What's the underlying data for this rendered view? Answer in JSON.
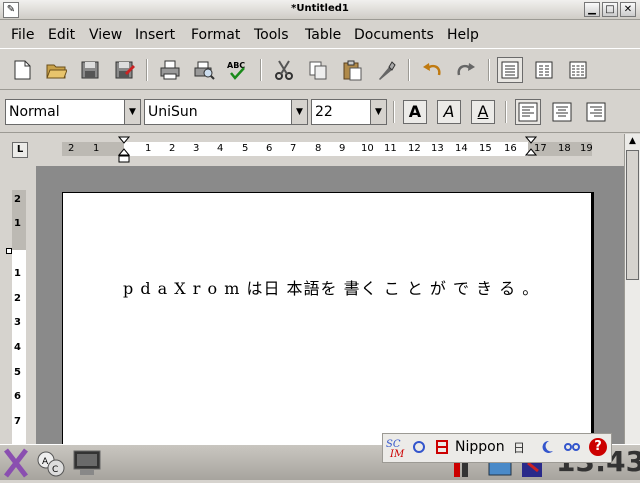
{
  "window": {
    "title": "*Untitled1",
    "min": "▁",
    "max": "□",
    "close": "✕"
  },
  "menu": [
    "File",
    "Edit",
    "View",
    "Insert",
    "Format",
    "Tools",
    "Table",
    "Documents",
    "Help"
  ],
  "format": {
    "style": "Normal",
    "font": "UniSun",
    "size": "22",
    "bold": "A",
    "italic": "A",
    "underline": "A"
  },
  "ruler": {
    "corner": "L",
    "h_ticks": [
      "2",
      "1",
      "1",
      "2",
      "3",
      "4",
      "5",
      "6",
      "7",
      "8",
      "9",
      "10",
      "11",
      "12",
      "13",
      "14",
      "15",
      "16",
      "17",
      "18",
      "19"
    ],
    "v_ticks": [
      "2",
      "1",
      "1",
      "2",
      "3",
      "4",
      "5",
      "6",
      "7"
    ]
  },
  "document": {
    "text": "p d a X r o m は日 本語を 書く こ と が で き る 。"
  },
  "im_panel": {
    "label": "Nippon",
    "mode": "日",
    "help": "?"
  },
  "clock": "13:43",
  "colors": {
    "accent": "#cc0000",
    "im_blue": "#3355cc"
  }
}
